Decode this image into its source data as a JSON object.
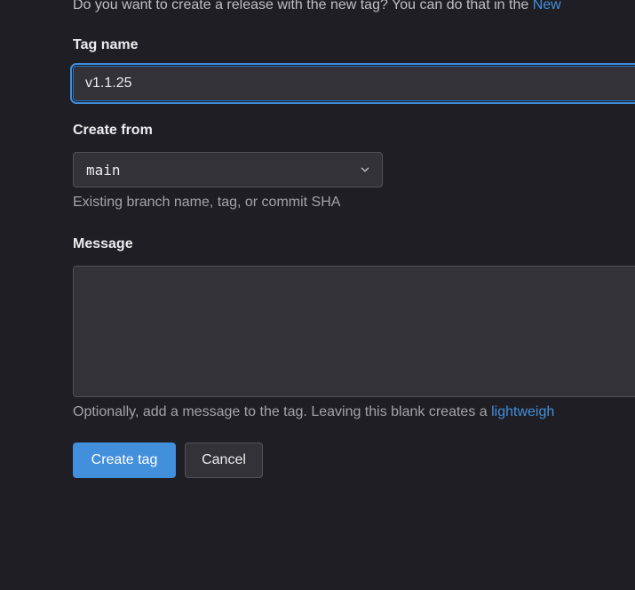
{
  "intro": {
    "text": "Do you want to create a release with the new tag? You can do that in the ",
    "link": "New"
  },
  "tag_name": {
    "label": "Tag name",
    "value": "v1.1.25"
  },
  "create_from": {
    "label": "Create from",
    "selected": "main",
    "icon": "chevron-down-icon",
    "help": "Existing branch name, tag, or commit SHA"
  },
  "message": {
    "label": "Message",
    "value": "",
    "help_text": "Optionally, add a message to the tag. Leaving this blank creates a ",
    "help_link": "lightweigh"
  },
  "actions": {
    "create_label": "Create tag",
    "cancel_label": "Cancel"
  },
  "colors": {
    "background": "#1f1e24",
    "input_background": "#333238",
    "accent": "#428fdc",
    "focus_ring": "#1f75cb"
  }
}
